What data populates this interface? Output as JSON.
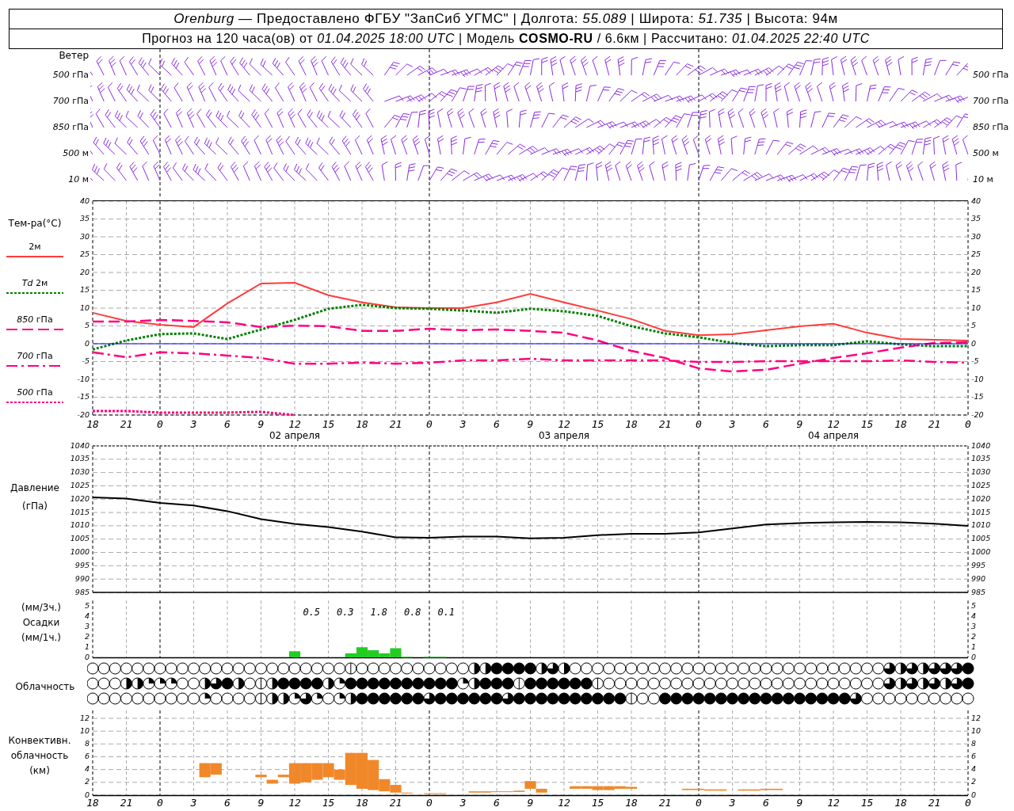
{
  "header": {
    "line_1": "*Orenburg* — Предоставлено ФГБУ \"ЗапСиб УГМС\" | Долгота: *55.089* | Широта: *51.735* | Высота: 94м",
    "line_2": "Прогноз на 120 часа(ов) от *01.04.2025 18:00 UTC*  | Модель **COSMO-RU** / 6.6км | Рассчитано: *01.04.2025 22:40 UTC*"
  },
  "wind": {
    "title": "Ветер",
    "levels": [
      "*500* гПа",
      "*700* гПа",
      "*850* гПа",
      "*500* м",
      "*10*  м"
    ],
    "right_levels": [
      "*500* гПа",
      "*700* гПа",
      "*850* гПа",
      "*500* м",
      "*10*  м"
    ]
  },
  "temperature": {
    "title": "Тем-ра(°C)",
    "right_axis": [
      "40",
      "35",
      "30",
      "25",
      "20",
      "15",
      "10",
      "5",
      "0",
      "-5",
      "-10",
      "-15",
      "-20"
    ],
    "chart_data": {
      "type": "line",
      "categories": [
        "18",
        "21",
        "0",
        "3",
        "6",
        "9",
        "12",
        "15",
        "18",
        "21",
        "0",
        "3",
        "6",
        "9",
        "12",
        "15",
        "18",
        "21",
        "0",
        "3",
        "6",
        "9",
        "12",
        "15",
        "18",
        "21",
        "0"
      ],
      "series": [
        {
          "name": "2м",
          "color": "#ff3b3b",
          "line_style": "solid",
          "values": [
            8.7,
            6.4,
            5.3,
            4.7,
            11.3,
            16.9,
            17.1,
            13.6,
            11.6,
            10.2,
            10,
            10,
            11.6,
            14,
            11.6,
            9.3,
            6.9,
            3.6,
            2.4,
            2.7,
            3.8,
            4.9,
            5.6,
            3.1,
            1.3,
            1.1,
            0.9
          ]
        },
        {
          "name": "*Td* 2м",
          "color": "#008000",
          "line_style": "dotted",
          "values": [
            -1.6,
            0.9,
            2.7,
            2.9,
            1.3,
            4,
            6.7,
            9.8,
            10.9,
            10,
            9.8,
            9.3,
            8.7,
            9.8,
            9.1,
            7.8,
            4.9,
            2.9,
            1.8,
            0.2,
            -0.7,
            -0.4,
            -0.4,
            0.7,
            -0.2,
            -0.7,
            -0.7
          ]
        },
        {
          "name": "*850* гПа",
          "color": "#ff0080",
          "line_style": "dashed",
          "values": [
            6.2,
            6.2,
            6.7,
            6.4,
            6,
            4.7,
            5.1,
            4.9,
            3.6,
            3.6,
            4.2,
            3.8,
            4,
            3.6,
            3.1,
            0.9,
            -2,
            -4,
            -6.9,
            -7.8,
            -7.3,
            -5.6,
            -4,
            -2.7,
            -1.1,
            0.2,
            0.4
          ]
        },
        {
          "name": "*700* гПа",
          "color": "#ff0080",
          "line_style": "dashdot",
          "values": [
            -2.4,
            -3.8,
            -2.4,
            -2.7,
            -3.3,
            -4,
            -5.6,
            -5.6,
            -5.3,
            -5.6,
            -5.3,
            -4.7,
            -4.7,
            -4.2,
            -4.7,
            -4.7,
            -4.7,
            -4.7,
            -5.1,
            -5.1,
            -4.9,
            -4.9,
            -4.9,
            -4.9,
            -4.7,
            -5.1,
            -5.3
          ]
        },
        {
          "name": "*500* гПа",
          "color": "#ff0080",
          "line_style": "dotted",
          "values": [
            -18.9,
            -18.9,
            -19.3,
            -19.3,
            -19.3,
            -19.1,
            -20,
            null,
            null,
            null,
            null,
            null,
            null,
            null,
            null,
            null,
            null,
            null,
            null,
            null,
            null,
            null,
            null,
            null,
            null,
            null,
            null
          ]
        },
        {
          "color": "#0000ff",
          "line_style": "solid",
          "values": [
            0,
            0,
            0,
            0,
            0,
            0,
            0,
            0,
            0,
            0,
            0,
            0,
            0,
            0,
            0,
            0,
            0,
            0,
            0,
            0,
            0,
            0,
            0,
            0,
            0,
            0,
            0
          ]
        }
      ],
      "ylim": [
        -20,
        40
      ],
      "yticks": [
        40,
        35,
        30,
        25,
        20,
        15,
        10,
        5,
        0,
        -5,
        -10,
        -15,
        -20
      ],
      "grid": true,
      "annotations": [
        "02 апреля",
        "03 апреля",
        "04 апреля"
      ]
    }
  },
  "pressure": {
    "labels": [
      "Давление",
      "(гПа)"
    ],
    "right_axis": [
      "1040",
      "1035",
      "1030",
      "1025",
      "1020",
      "1015",
      "1010",
      "1005",
      "1000",
      "995",
      "990",
      "985"
    ],
    "chart_data": {
      "type": "line",
      "categories": [
        null,
        null,
        null,
        null,
        null,
        null,
        null,
        null,
        null,
        null,
        null,
        null,
        null,
        null,
        null,
        null,
        null,
        null,
        null,
        null,
        null,
        null,
        null,
        null,
        null,
        null,
        null
      ],
      "series": [
        {
          "color": "#000000",
          "values": [
            1020.7,
            1020.2,
            1018.6,
            1017.6,
            1015.5,
            1012.5,
            1010.7,
            1009.5,
            1007.8,
            1005.7,
            1005.5,
            1006,
            1006,
            1005.3,
            1005.5,
            1006.5,
            1007,
            1007,
            1007.5,
            1009,
            1010.5,
            1011,
            1011.3,
            1011.5,
            1011.3,
            1010.8,
            1010
          ]
        }
      ],
      "ylim": [
        985,
        1040
      ],
      "yticks": [
        1040,
        1035,
        1030,
        1025,
        1020,
        1015,
        1010,
        1005,
        1000,
        995,
        990,
        985
      ],
      "grid": true
    }
  },
  "precipitation": {
    "labels": [
      "(мм/3ч.)",
      "Осадки",
      "(мм/1ч.)"
    ],
    "right_axis": [
      "5",
      "4",
      "3",
      "2",
      "1",
      "0"
    ],
    "chart_data": {
      "type": "bar",
      "categories": [
        null,
        null,
        null,
        null,
        null,
        null,
        null,
        null,
        null,
        null,
        null,
        null,
        null,
        null,
        null,
        null,
        null,
        null,
        null,
        null,
        null,
        null,
        null,
        null,
        null,
        null,
        null,
        null,
        null,
        null,
        null,
        null,
        null,
        null,
        null,
        null,
        null,
        null,
        null,
        null,
        null,
        null,
        null,
        null,
        null,
        null,
        null,
        null,
        null,
        null,
        null,
        null,
        null,
        null,
        null,
        null,
        null,
        null,
        null,
        null,
        null,
        null,
        null,
        null,
        null,
        null,
        null,
        null,
        null,
        null,
        null,
        null,
        null,
        null,
        null,
        null,
        null,
        null,
        null
      ],
      "values": [
        null,
        null,
        null,
        null,
        null,
        null,
        null,
        null,
        null,
        null,
        null,
        null,
        null,
        null,
        null,
        null,
        null,
        null,
        0.6,
        null,
        null,
        null,
        null,
        0.4,
        1.0,
        0.7,
        0.4,
        0.9,
        0.05,
        null,
        0.05,
        0.05,
        null,
        null,
        null,
        null,
        null,
        null,
        null,
        null,
        null,
        null,
        null,
        null,
        null,
        null,
        null,
        null,
        null,
        null,
        null,
        null,
        null,
        null,
        null,
        null,
        null,
        null,
        null,
        null,
        null,
        null,
        null,
        null,
        null,
        null,
        null,
        null,
        null,
        null,
        null,
        null,
        null,
        null,
        null,
        null,
        null,
        null,
        null
      ],
      "ylim": [
        0,
        5.6
      ],
      "yticks": [
        5,
        4,
        3,
        2,
        1,
        0
      ],
      "grid": true,
      "annotations": [
        "0.5",
        "0.3",
        "1.8",
        "0.8",
        "0.1"
      ]
    }
  },
  "cloudiness": {
    "label": "Облачность",
    "rows": [
      {
        "cells": [
          {
            "kind": "clear"
          },
          {
            "kind": "clear"
          },
          {
            "kind": "clear"
          },
          {
            "kind": "clear"
          },
          {
            "kind": "clear"
          },
          {
            "kind": "clear"
          },
          {
            "kind": "clear"
          },
          {
            "kind": "clear"
          },
          {
            "kind": "clear"
          },
          {
            "kind": "clear"
          },
          {
            "kind": "clear"
          },
          {
            "kind": "clear"
          },
          {
            "kind": "clear"
          },
          {
            "kind": "clear"
          },
          {
            "kind": "clear"
          },
          {
            "kind": "clear"
          },
          {
            "kind": "clear"
          },
          {
            "kind": "clear"
          },
          {
            "kind": "clear"
          },
          {
            "kind": "clear"
          },
          {
            "kind": "clear"
          },
          {
            "kind": "clear"
          },
          {
            "kind": "clear"
          },
          {
            "kind": "trace"
          },
          {
            "kind": "clear"
          },
          {
            "kind": "clear"
          },
          {
            "kind": "clear"
          },
          {
            "kind": "clear"
          },
          {
            "kind": "clear"
          },
          {
            "kind": "clear"
          },
          {
            "kind": "clear"
          },
          {
            "kind": "clear"
          },
          {
            "kind": "clear"
          },
          {
            "kind": "clear"
          },
          {
            "kind": "half"
          },
          {
            "kind": "half"
          },
          {
            "kind": "overcast"
          },
          {
            "kind": "overcast"
          },
          {
            "kind": "overcast"
          },
          {
            "kind": "overcast"
          },
          {
            "kind": "half"
          },
          {
            "kind": "most"
          },
          {
            "kind": "half"
          },
          {
            "kind": "clear"
          },
          {
            "kind": "clear"
          },
          {
            "kind": "clear"
          },
          {
            "kind": "clear"
          },
          {
            "kind": "clear"
          },
          {
            "kind": "clear"
          },
          {
            "kind": "clear"
          },
          {
            "kind": "clear"
          },
          {
            "kind": "clear"
          },
          {
            "kind": "clear"
          },
          {
            "kind": "clear"
          },
          {
            "kind": "clear"
          },
          {
            "kind": "clear"
          },
          {
            "kind": "clear"
          },
          {
            "kind": "clear"
          },
          {
            "kind": "clear"
          },
          {
            "kind": "clear"
          },
          {
            "kind": "clear"
          },
          {
            "kind": "clear"
          },
          {
            "kind": "clear"
          },
          {
            "kind": "clear"
          },
          {
            "kind": "clear"
          },
          {
            "kind": "clear"
          },
          {
            "kind": "clear"
          },
          {
            "kind": "clear"
          },
          {
            "kind": "clear"
          },
          {
            "kind": "clear"
          },
          {
            "kind": "clear"
          },
          {
            "kind": "most"
          },
          {
            "kind": "half"
          },
          {
            "kind": "most"
          },
          {
            "kind": "half"
          },
          {
            "kind": "most"
          },
          {
            "kind": "most"
          },
          {
            "kind": "most"
          },
          {
            "kind": "overcast"
          }
        ]
      },
      {
        "cells": [
          {
            "kind": "clear"
          },
          {
            "kind": "clear"
          },
          {
            "kind": "clear"
          },
          {
            "kind": "half"
          },
          {
            "kind": "half"
          },
          {
            "kind": "quarter"
          },
          {
            "kind": "quarter"
          },
          {
            "kind": "quarter"
          },
          {
            "kind": "clear"
          },
          {
            "kind": "clear"
          },
          {
            "kind": "half"
          },
          {
            "kind": "most"
          },
          {
            "kind": "overcast"
          },
          {
            "kind": "half"
          },
          {
            "kind": "clear"
          },
          {
            "kind": "trace"
          },
          {
            "kind": "half"
          },
          {
            "kind": "overcast"
          },
          {
            "kind": "overcast"
          },
          {
            "kind": "overcast"
          },
          {
            "kind": "overcast"
          },
          {
            "kind": "half"
          },
          {
            "kind": "quarter"
          },
          {
            "kind": "overcast"
          },
          {
            "kind": "overcast"
          },
          {
            "kind": "overcast"
          },
          {
            "kind": "overcast"
          },
          {
            "kind": "overcast"
          },
          {
            "kind": "overcast"
          },
          {
            "kind": "overcast"
          },
          {
            "kind": "overcast"
          },
          {
            "kind": "overcast"
          },
          {
            "kind": "overcast"
          },
          {
            "kind": "quarter"
          },
          {
            "kind": "half"
          },
          {
            "kind": "overcast"
          },
          {
            "kind": "overcast"
          },
          {
            "kind": "overcast"
          },
          {
            "kind": "trace"
          },
          {
            "kind": "overcast"
          },
          {
            "kind": "overcast"
          },
          {
            "kind": "overcast"
          },
          {
            "kind": "overcast"
          },
          {
            "kind": "overcast"
          },
          {
            "kind": "overcast"
          },
          {
            "kind": "trace"
          },
          {
            "kind": "clear"
          },
          {
            "kind": "clear"
          },
          {
            "kind": "clear"
          },
          {
            "kind": "clear"
          },
          {
            "kind": "clear"
          },
          {
            "kind": "clear"
          },
          {
            "kind": "clear"
          },
          {
            "kind": "clear"
          },
          {
            "kind": "clear"
          },
          {
            "kind": "clear"
          },
          {
            "kind": "clear"
          },
          {
            "kind": "clear"
          },
          {
            "kind": "clear"
          },
          {
            "kind": "clear"
          },
          {
            "kind": "clear"
          },
          {
            "kind": "clear"
          },
          {
            "kind": "clear"
          },
          {
            "kind": "clear"
          },
          {
            "kind": "clear"
          },
          {
            "kind": "clear"
          },
          {
            "kind": "clear"
          },
          {
            "kind": "clear"
          },
          {
            "kind": "clear"
          },
          {
            "kind": "clear"
          },
          {
            "kind": "clear"
          },
          {
            "kind": "most"
          },
          {
            "kind": "half"
          },
          {
            "kind": "most"
          },
          {
            "kind": "half"
          },
          {
            "kind": "most"
          },
          {
            "kind": "half"
          },
          {
            "kind": "most"
          },
          {
            "kind": "overcast"
          }
        ]
      },
      {
        "cells": [
          {
            "kind": "clear"
          },
          {
            "kind": "clear"
          },
          {
            "kind": "clear"
          },
          {
            "kind": "clear"
          },
          {
            "kind": "clear"
          },
          {
            "kind": "clear"
          },
          {
            "kind": "clear"
          },
          {
            "kind": "clear"
          },
          {
            "kind": "clear"
          },
          {
            "kind": "clear"
          },
          {
            "kind": "quarter"
          },
          {
            "kind": "clear"
          },
          {
            "kind": "clear"
          },
          {
            "kind": "clear"
          },
          {
            "kind": "clear"
          },
          {
            "kind": "trace"
          },
          {
            "kind": "half"
          },
          {
            "kind": "half"
          },
          {
            "kind": "quarter"
          },
          {
            "kind": "most"
          },
          {
            "kind": "quarter"
          },
          {
            "kind": "clear"
          },
          {
            "kind": "quarter"
          },
          {
            "kind": "half"
          },
          {
            "kind": "overcast"
          },
          {
            "kind": "overcast"
          },
          {
            "kind": "overcast"
          },
          {
            "kind": "overcast"
          },
          {
            "kind": "overcast"
          },
          {
            "kind": "overcast"
          },
          {
            "kind": "most"
          },
          {
            "kind": "overcast"
          },
          {
            "kind": "overcast"
          },
          {
            "kind": "overcast"
          },
          {
            "kind": "overcast"
          },
          {
            "kind": "overcast"
          },
          {
            "kind": "overcast"
          },
          {
            "kind": "most"
          },
          {
            "kind": "overcast"
          },
          {
            "kind": "overcast"
          },
          {
            "kind": "overcast"
          },
          {
            "kind": "overcast"
          },
          {
            "kind": "overcast"
          },
          {
            "kind": "overcast"
          },
          {
            "kind": "overcast"
          },
          {
            "kind": "overcast"
          },
          {
            "kind": "overcast"
          },
          {
            "kind": "overcast"
          },
          {
            "kind": "trace"
          },
          {
            "kind": "clear"
          },
          {
            "kind": "clear"
          },
          {
            "kind": "overcast"
          },
          {
            "kind": "overcast"
          },
          {
            "kind": "overcast"
          },
          {
            "kind": "overcast"
          },
          {
            "kind": "overcast"
          },
          {
            "kind": "overcast"
          },
          {
            "kind": "overcast"
          },
          {
            "kind": "overcast"
          },
          {
            "kind": "overcast"
          },
          {
            "kind": "overcast"
          },
          {
            "kind": "overcast"
          },
          {
            "kind": "overcast"
          },
          {
            "kind": "overcast"
          },
          {
            "kind": "overcast"
          },
          {
            "kind": "overcast"
          },
          {
            "kind": "overcast"
          },
          {
            "kind": "overcast"
          },
          {
            "kind": "most"
          },
          {
            "kind": "clear"
          },
          {
            "kind": "clear"
          },
          {
            "kind": "clear"
          },
          {
            "kind": "clear"
          },
          {
            "kind": "clear"
          },
          {
            "kind": "clear"
          },
          {
            "kind": "clear"
          },
          {
            "kind": "clear"
          },
          {
            "kind": "clear"
          },
          {
            "kind": "clear"
          }
        ]
      }
    ]
  },
  "convective": {
    "labels": [
      "Конвективн.",
      "облачность",
      "(км)"
    ],
    "right_axis": [
      "12",
      "10",
      "8",
      "6",
      "4",
      "2",
      "0"
    ],
    "chart_data": {
      "type": "candlestick",
      "categories": [
        "18",
        null,
        null,
        "21",
        null,
        null,
        "0",
        null,
        null,
        "3",
        null,
        null,
        "6",
        null,
        null,
        "9",
        null,
        null,
        "12",
        null,
        null,
        "15",
        null,
        null,
        "18",
        null,
        null,
        "21",
        null,
        null,
        "0",
        null,
        null,
        "3",
        null,
        null,
        "6",
        null,
        null,
        "9",
        null,
        null,
        "12",
        null,
        null,
        "15",
        null,
        null,
        "18",
        null,
        null,
        "21",
        null,
        null,
        "0",
        null,
        null,
        "3",
        null,
        null,
        "6",
        null,
        null,
        "9",
        null,
        null,
        "12",
        null,
        null,
        "15",
        null,
        null,
        "18",
        null,
        null,
        "21",
        null,
        null,
        "0"
      ],
      "ohlc": [
        null,
        null,
        null,
        null,
        null,
        null,
        null,
        null,
        null,
        null,
        [
          2.8,
          5,
          2.8,
          5
        ],
        [
          3.2,
          5,
          3.2,
          5
        ],
        null,
        null,
        null,
        [
          2.8,
          3.2,
          2.8,
          3.2
        ],
        [
          1.8,
          2.4,
          1.8,
          2.4
        ],
        [
          2.8,
          3.2,
          2.8,
          3.2
        ],
        [
          1.8,
          5,
          1.8,
          5
        ],
        [
          2.0,
          5,
          2.0,
          5
        ],
        [
          2.4,
          5,
          2.4,
          5
        ],
        [
          2.8,
          5,
          2.8,
          5
        ],
        [
          2.4,
          4,
          2.4,
          4
        ],
        [
          1.6,
          6.6,
          1.6,
          6.6
        ],
        [
          1.0,
          6.6,
          1.0,
          6.6
        ],
        [
          0.8,
          5.5,
          0.8,
          5.5
        ],
        [
          0.6,
          2.5,
          0.6,
          2.5
        ],
        [
          0.4,
          1.6,
          0.4,
          1.6
        ],
        [
          0.3,
          0.4,
          0.3,
          0.4
        ],
        null,
        [
          0.2,
          0.3,
          0.2,
          0.3
        ],
        [
          0.2,
          0.3,
          0.2,
          0.3
        ],
        null,
        null,
        [
          0.4,
          0.6,
          0.4,
          0.6
        ],
        [
          0.4,
          0.6,
          0.4,
          0.6
        ],
        [
          0.5,
          0.6,
          0.5,
          0.6
        ],
        [
          0.5,
          0.6,
          0.5,
          0.6
        ],
        [
          0.5,
          0.7,
          0.5,
          0.7
        ],
        [
          1.0,
          2.2,
          1.0,
          2.2
        ],
        [
          0.4,
          1.0,
          0.4,
          1.0
        ],
        null,
        null,
        [
          1.0,
          1.4,
          1.0,
          1.4
        ],
        [
          1.0,
          1.4,
          1.0,
          1.4
        ],
        [
          0.8,
          1.4,
          0.8,
          1.4
        ],
        [
          0.8,
          1.4,
          0.8,
          1.4
        ],
        [
          1.0,
          1.4,
          1.0,
          1.4
        ],
        [
          1.0,
          1.3,
          1.0,
          1.3
        ],
        null,
        null,
        null,
        null,
        [
          0.8,
          1.0,
          0.8,
          1.0
        ],
        [
          0.8,
          1.0,
          0.8,
          1.0
        ],
        [
          0.7,
          0.9,
          0.7,
          0.9
        ],
        [
          0.7,
          0.9,
          0.7,
          0.9
        ],
        null,
        [
          0.7,
          0.9,
          0.7,
          0.9
        ],
        [
          0.7,
          0.9,
          0.7,
          0.9
        ],
        [
          0.8,
          1.0,
          0.8,
          1.0
        ],
        [
          0.8,
          1.0,
          0.8,
          1.0
        ],
        null,
        null,
        null,
        null,
        null,
        null,
        null,
        null,
        null,
        null,
        null,
        null,
        null,
        null,
        null,
        null,
        null
      ],
      "ylim": [
        0,
        12
      ],
      "yticks": [
        12,
        10,
        8,
        6,
        4,
        2,
        0
      ],
      "grid": true
    }
  }
}
